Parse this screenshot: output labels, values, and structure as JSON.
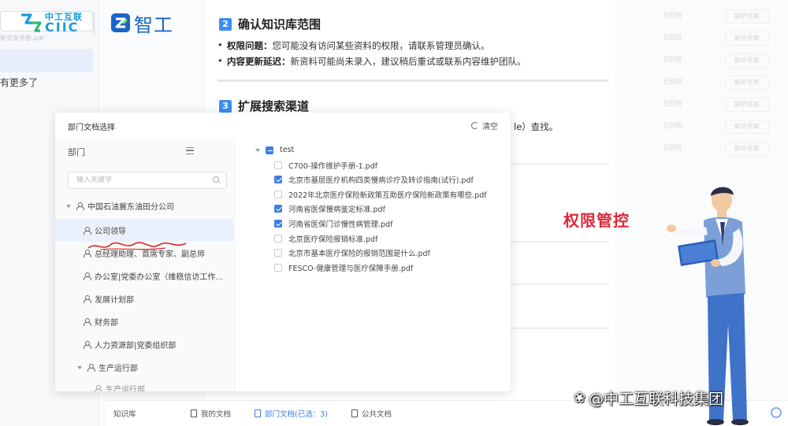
{
  "app": {
    "brand_cn": "中工互联",
    "brand_en": "CIIC",
    "product": "智工"
  },
  "background_left": {
    "file_hint": "新农家手册.pdf",
    "more_text": "有更多了"
  },
  "doc": {
    "section2": {
      "num": "2",
      "title": "确认知识库范围",
      "bullets": [
        {
          "label": "权限问题：",
          "text": "您可能没有访问某些资料的权限，请联系管理员确认。"
        },
        {
          "label": "内容更新延迟：",
          "text": "新资料可能尚未录入，建议稍后重试或联系内容维护团队。"
        }
      ]
    },
    "section3": {
      "num": "3",
      "title": "扩展搜索渠道",
      "trailing_text": "le）查找。"
    }
  },
  "background_right": {
    "tag": "已回答",
    "button": "解析答案"
  },
  "bottom_bar": {
    "knowledge_base": "知识库",
    "tabs": [
      {
        "label": "我的文档",
        "active": false
      },
      {
        "label": "部门文档(已选：3)",
        "active": true
      },
      {
        "label": "公共文档",
        "active": false
      }
    ]
  },
  "modal": {
    "title": "部门文档选择",
    "clear_label": "清空",
    "dept_header": "部门",
    "search_placeholder": "输入关键字",
    "root_dept": "中国石油冀东油田分公司",
    "departments": [
      "公司领导",
      "总经理助理、首席专家、副总师",
      "办公室|党委办公室（维稳信访工作...",
      "发展计划部",
      "财务部",
      "人力资源部|党委组织部"
    ],
    "group_dept": "生产运行部",
    "group_child": "生产运行部",
    "folder": "test",
    "files": [
      {
        "name": "C700-操作维护手册-1.pdf",
        "checked": false
      },
      {
        "name": "北京市基层医疗机构四类慢病诊疗及转诊指南(试行).pdf",
        "checked": true
      },
      {
        "name": "2022年北京医疗保险新政策互助医疗保险新政策有哪些.pdf",
        "checked": false
      },
      {
        "name": "河南省医保慢病鉴定标准.pdf",
        "checked": true
      },
      {
        "name": "河南省医保门诊慢性病管理.pdf",
        "checked": true
      },
      {
        "name": "北京医疗保险报销标准.pdf",
        "checked": false
      },
      {
        "name": "北京市基本医疗保险的报销范围是什么.pdf",
        "checked": false
      },
      {
        "name": "FESCO-健康管理与医疗保障手册.pdf",
        "checked": false
      }
    ]
  },
  "overlay": {
    "label": "权限管控",
    "watermark": "@中工互联科技集团",
    "watermark_icon": "paw-icon"
  },
  "colors": {
    "accent": "#3d7fe0",
    "section_badge": "#3d8ef0",
    "overlay_red": "#e0283a",
    "brand_blue": "#1a9bd7"
  }
}
